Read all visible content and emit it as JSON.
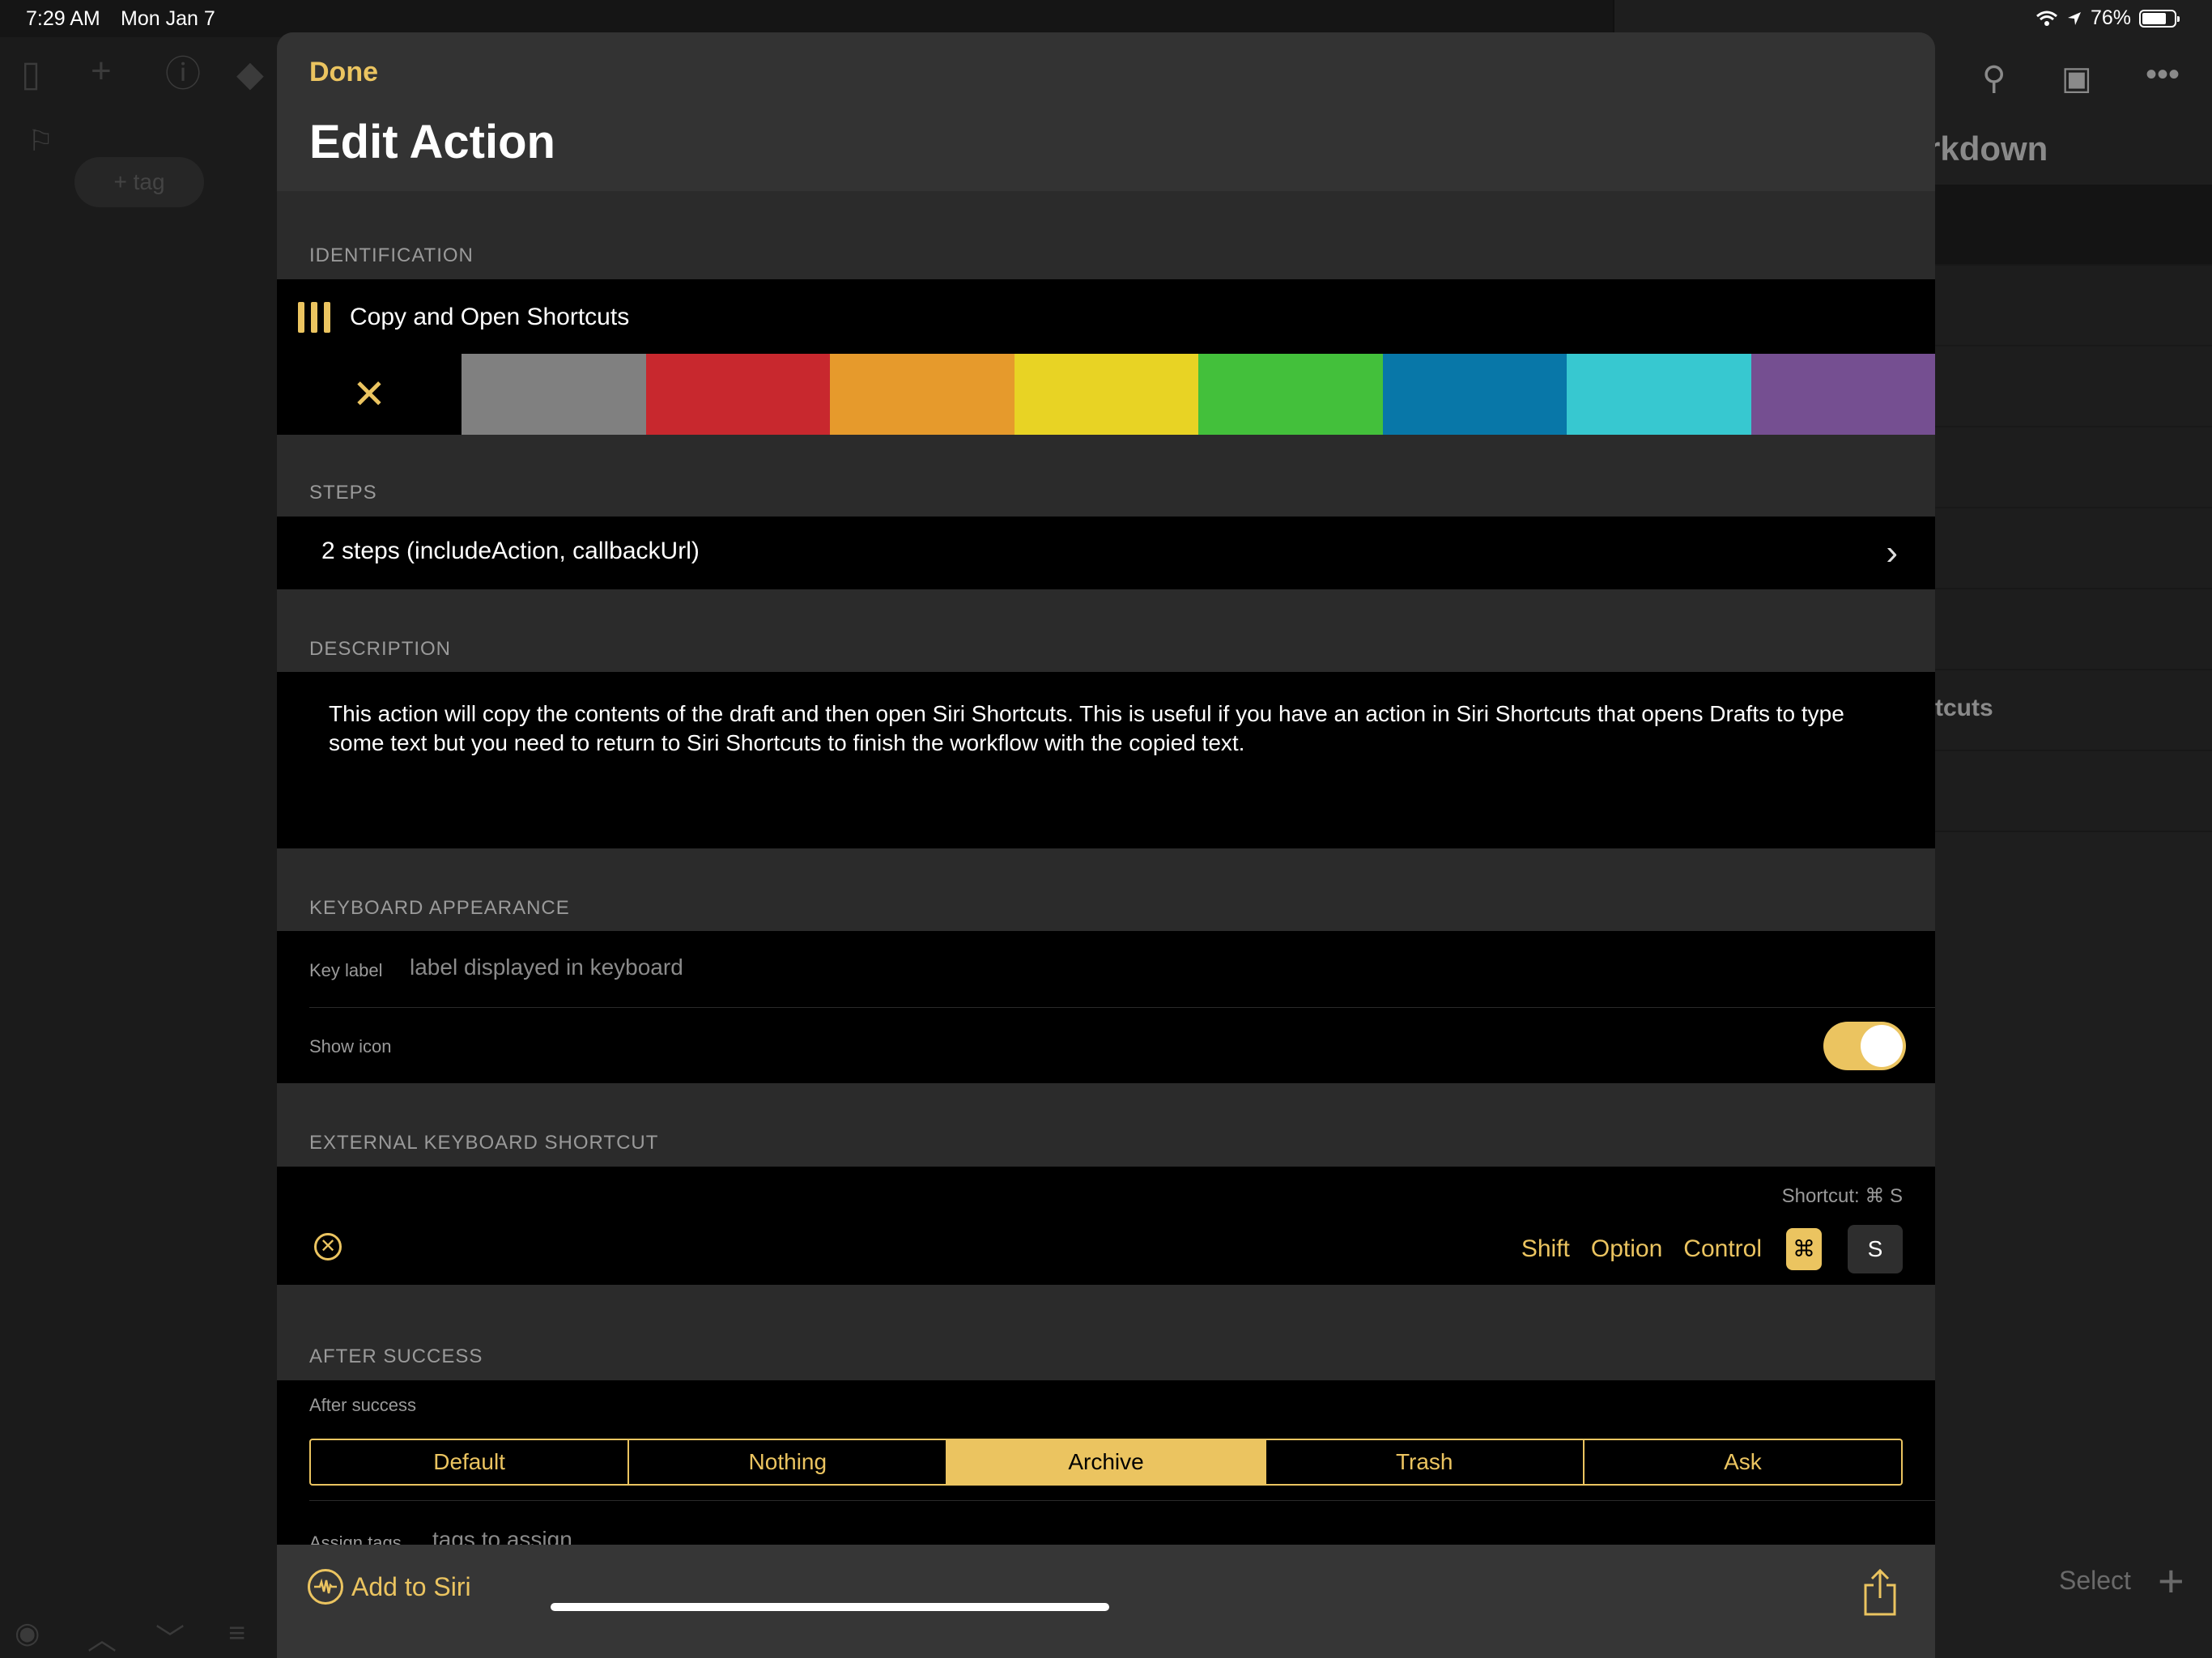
{
  "status": {
    "time": "7:29 AM",
    "date": "Mon Jan 7",
    "battery": "76%"
  },
  "background": {
    "tag_pill": "+ tag",
    "right_title_fragment": "rkdown",
    "right_row_fragment": "tcuts",
    "select_label": "Select"
  },
  "modal": {
    "done_label": "Done",
    "title": "Edit Action",
    "identification": {
      "section": "IDENTIFICATION",
      "action_name": "Copy and Open Shortcuts",
      "colors": [
        "#808080",
        "#C8282E",
        "#E69A2C",
        "#E8D324",
        "#43C03B",
        "#0877A8",
        "#37C8D0",
        "#754F91"
      ]
    },
    "steps": {
      "section": "STEPS",
      "summary": "2 steps (includeAction, callbackUrl)"
    },
    "description": {
      "section": "DESCRIPTION",
      "text": "This action will copy the contents of the draft and then open Siri Shortcuts. This is useful if you have an action in Siri Shortcuts that opens Drafts to type some text but you need to return to Siri Shortcuts to finish the workflow with the copied text."
    },
    "keyboard_appearance": {
      "section": "KEYBOARD APPEARANCE",
      "key_label": "Key label",
      "key_placeholder": "label displayed in keyboard",
      "show_icon_label": "Show icon",
      "show_icon": true
    },
    "external_shortcut": {
      "section": "EXTERNAL KEYBOARD SHORTCUT",
      "shortcut_text": "Shortcut: ⌘ S",
      "modifiers": [
        "Shift",
        "Option",
        "Control"
      ],
      "command_glyph": "⌘",
      "key": "S"
    },
    "after_success": {
      "section": "AFTER SUCCESS",
      "label": "After success",
      "options": [
        "Default",
        "Nothing",
        "Archive",
        "Trash",
        "Ask"
      ],
      "selected": "Archive",
      "assign_tags_label": "Assign tags",
      "assign_tags_placeholder": "tags to assign"
    },
    "footer": {
      "siri_label": "Add to Siri"
    }
  },
  "accent_color": "#EBC460"
}
